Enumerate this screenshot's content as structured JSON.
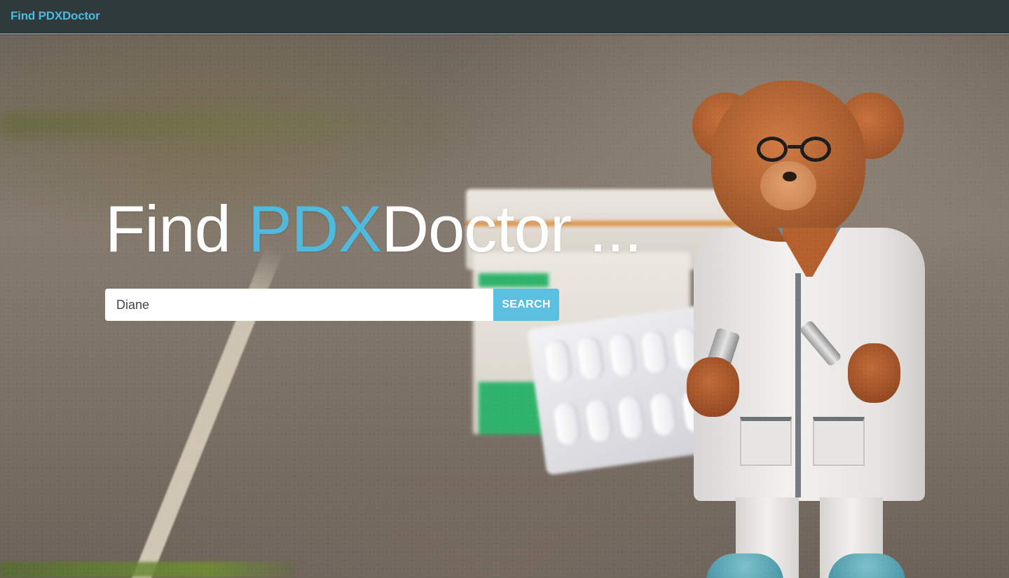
{
  "navbar": {
    "brand": "Find PDXDoctor"
  },
  "hero": {
    "headline_prefix": "Find ",
    "headline_accent": "PDX",
    "headline_suffix": "Doctor ...",
    "background_image": "teddy-bear-doctor-with-pills"
  },
  "search": {
    "value": "Diane",
    "button_label": "SEARCH"
  },
  "colors": {
    "navbar_bg": "#2e3a3b",
    "accent": "#4fb9de",
    "button_bg": "#5bbfe0"
  }
}
